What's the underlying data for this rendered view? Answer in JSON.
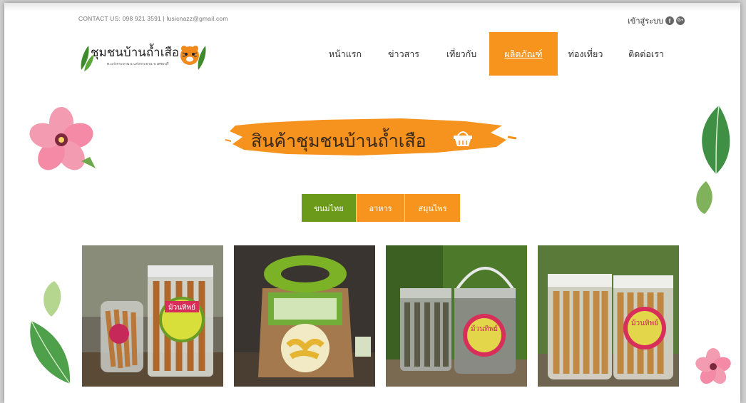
{
  "header": {
    "contact": "CONTACT US: 098 921 3591 | lusicnazz@gmail.com",
    "login": "เข้าสู่ระบบ",
    "social": [
      {
        "icon": "facebook-icon",
        "glyph": "f"
      },
      {
        "icon": "google-plus-icon",
        "glyph": "G+"
      }
    ]
  },
  "logo": {
    "title": "ชุมชนบ้านถ้ำเสือ",
    "subtitle": "ต.แก่งกระจาน อ.แก่งกระจาน จ.เพชรบุรี"
  },
  "nav": {
    "items": [
      {
        "label": "หน้าแรก",
        "active": false
      },
      {
        "label": "ข่าวสาร",
        "active": false
      },
      {
        "label": "เที่ยวกับ",
        "active": false
      },
      {
        "label": "ผลิตภัณฑ์",
        "active": true
      },
      {
        "label": "ท่องเที่ยว",
        "active": false
      },
      {
        "label": "ติดต่อเรา",
        "active": false
      }
    ]
  },
  "banner": {
    "title": "สินค้าชุมชนบ้านถ้ำเสือ"
  },
  "tabs": [
    {
      "label": "ขนมไทย",
      "active": true
    },
    {
      "label": "อาหาร",
      "active": false
    },
    {
      "label": "สมุนไพร",
      "active": false
    }
  ],
  "products": [
    {
      "name": "product-crispy-rolls-jar",
      "label": "ม้วนทิพย์"
    },
    {
      "name": "product-banana-chips-bag"
    },
    {
      "name": "product-bucket-snacks",
      "label": "ม้วนทิพย์"
    },
    {
      "name": "product-clear-tubs",
      "label": "ม้วนทิพย์"
    }
  ],
  "colors": {
    "accent": "#f7941d",
    "active_tab": "#6b9a1a",
    "text": "#333333"
  }
}
